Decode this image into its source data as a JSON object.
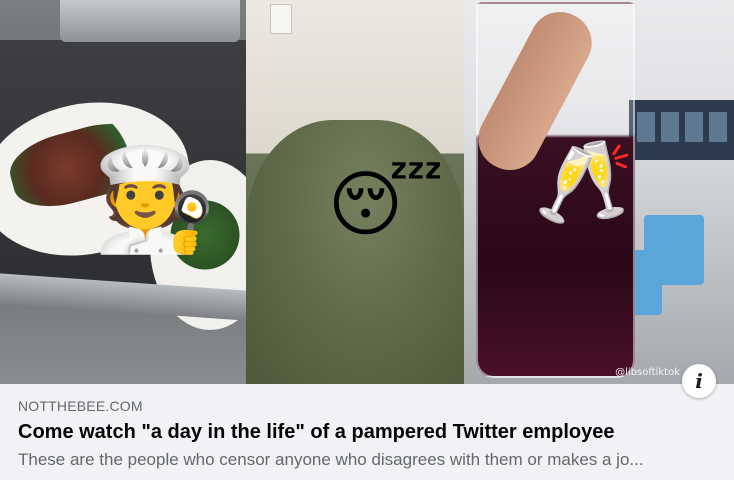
{
  "link_preview": {
    "domain": "NOTTHEBEE.COM",
    "title": "Come watch \"a day in the life\" of a pampered Twitter employee",
    "description": "These are the people who censor anyone who disagrees with them or makes a jo...",
    "info_icon_glyph": "i"
  },
  "image": {
    "watermark": "@libsoftiktok",
    "panels": [
      {
        "subject": "plated food on counter",
        "emoji_icon": "chef-emoji"
      },
      {
        "subject": "sleeping under green blanket",
        "emoji_icon": "sleeping-face-emoji"
      },
      {
        "subject": "glass of red drink, patio with blue chairs",
        "emoji_icon": "clinking-glasses-emoji"
      }
    ]
  },
  "colors": {
    "card_bg": "#f0f2f5",
    "title_text": "#050505",
    "secondary_text": "#65676b"
  }
}
